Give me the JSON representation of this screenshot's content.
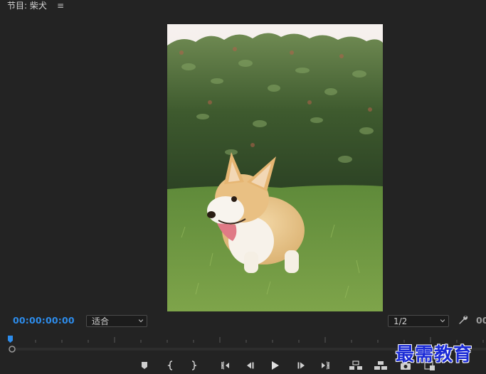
{
  "panel": {
    "title": "节目: 柴犬",
    "menu_glyph": "≡"
  },
  "video": {
    "subject": "corgi-dog-photo"
  },
  "controls": {
    "timecode": "00:00:00:00",
    "zoom": "适合",
    "quality": "1/2",
    "timecode_end_partial": "00"
  },
  "transport": {
    "buttons": [
      "add-marker-icon",
      "mark-in-icon",
      "mark-out-icon",
      "go-to-in-icon",
      "step-back-icon",
      "play-icon",
      "step-forward-icon",
      "go-to-out-icon",
      "lift-icon",
      "extract-icon",
      "export-frame-icon",
      "button-editor-icon"
    ]
  },
  "watermark": "最需教育",
  "colors": {
    "background": "#232323",
    "timecode": "#2d8ceb",
    "playhead": "#2d8ceb",
    "watermark": "#1b2bd6"
  }
}
